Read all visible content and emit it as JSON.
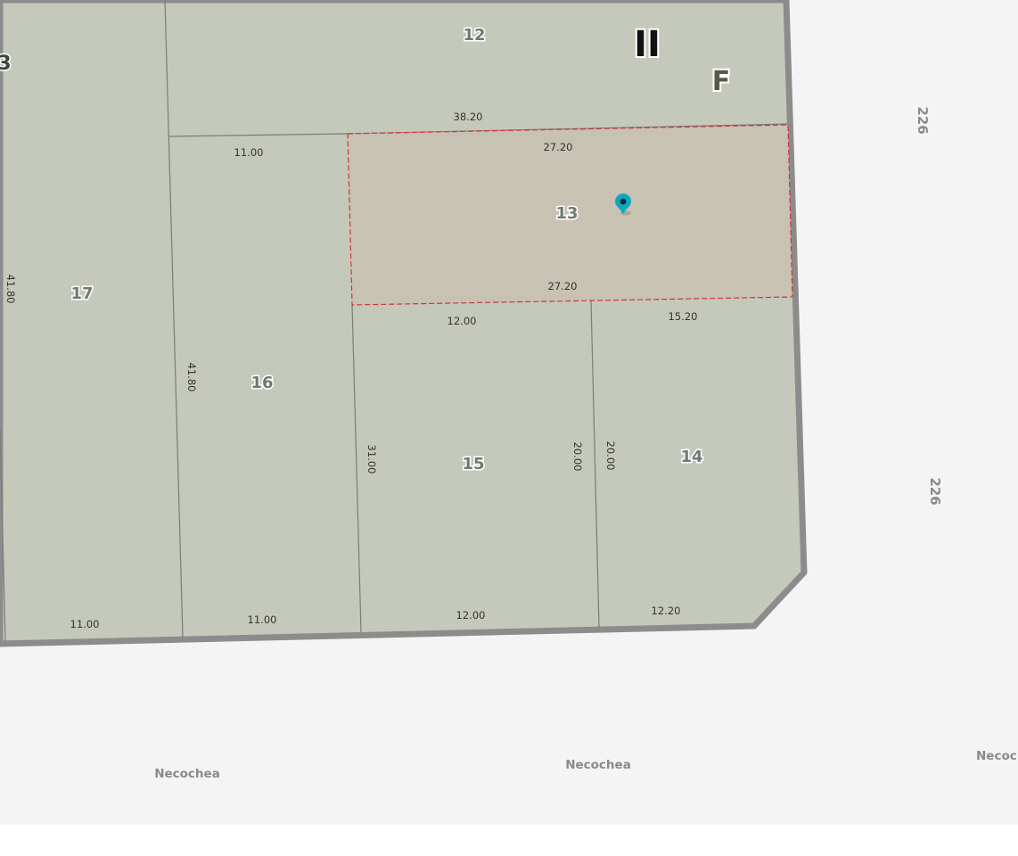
{
  "map": {
    "block": {
      "roman_numeral": "II",
      "letter": "F",
      "edge_lot_partial": "3"
    },
    "lots": [
      {
        "id": "12",
        "label": "12"
      },
      {
        "id": "13",
        "label": "13",
        "selected": true
      },
      {
        "id": "14",
        "label": "14"
      },
      {
        "id": "15",
        "label": "15"
      },
      {
        "id": "16",
        "label": "16"
      },
      {
        "id": "17",
        "label": "17"
      }
    ],
    "dimensions": {
      "lot12_bottom": "38.20",
      "lot16_top": "11.00",
      "lot13_top": "27.20",
      "lot13_bottom": "27.20",
      "lot15_top": "12.00",
      "lot14_top": "15.20",
      "lot17_side": "41.80",
      "lot16_side": "41.80",
      "lot15_left": "31.00",
      "lot15_right": "20.00",
      "lot14_left": "20.00",
      "lot17_bottom": "11.00",
      "lot16_bottom": "11.00",
      "lot15_bottom": "12.00",
      "lot14_bottom": "12.20"
    },
    "streets": {
      "south": "Necochea",
      "south_mid": "Necochea",
      "south_right_partial": "Necoc",
      "east_number_upper": "226",
      "east_number_lower": "226"
    },
    "colors": {
      "block_fill": "#c5c9bb",
      "selected_fill": "#c7c2b2",
      "selected_outline": "#d2323c",
      "block_border": "#8c8c8c",
      "background": "#f4f4f4",
      "marker": "#0fa7bf"
    },
    "marker_icon": "location-pin-icon"
  }
}
